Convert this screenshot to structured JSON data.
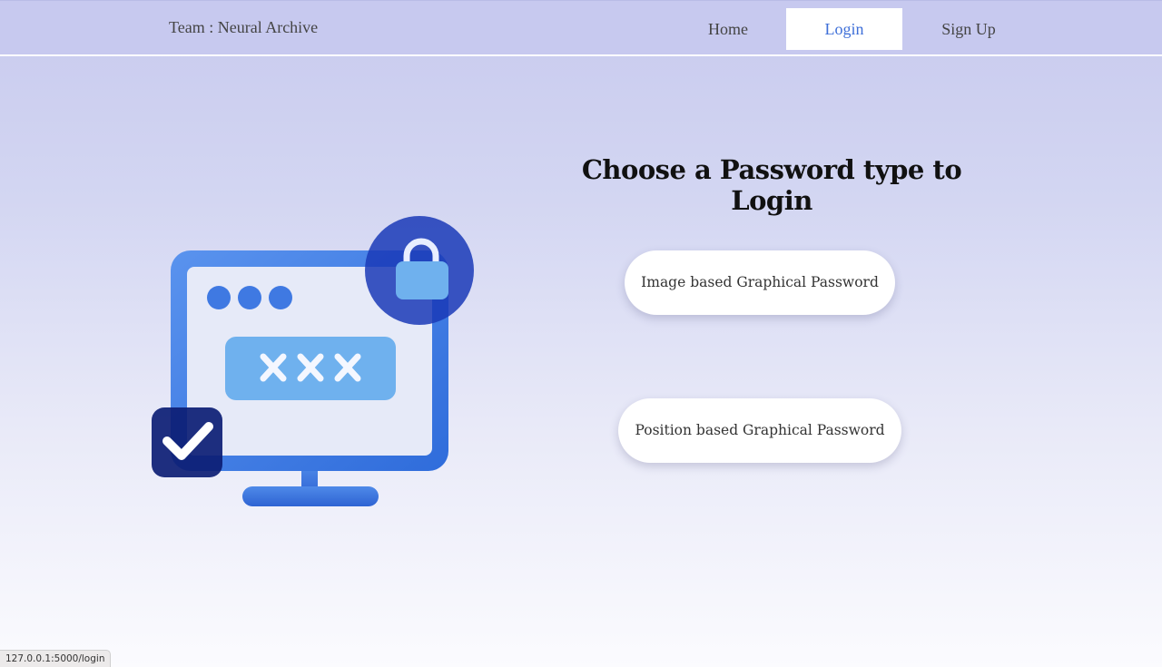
{
  "navbar": {
    "brand": "Team : Neural Archive",
    "items": [
      {
        "label": "Home",
        "active": false
      },
      {
        "label": "Login",
        "active": true
      },
      {
        "label": "Sign Up",
        "active": false
      }
    ]
  },
  "main": {
    "heading": "Choose a Password type to Login",
    "options": [
      {
        "label": "Image based Graphical Password"
      },
      {
        "label": "Position based Graphical Password"
      }
    ]
  },
  "illustration": {
    "icon": "monitor-password-lock-icon",
    "password_mask": "XXX",
    "colors": {
      "monitor": "#3f7ce3",
      "screen": "#e6eaf8",
      "lock_circle": "#1a3ab7",
      "check_square": "#0c1d74",
      "password_field": "#6fb1ee"
    }
  },
  "status_bar": {
    "url": "127.0.0.1:5000/login"
  },
  "theme": {
    "accent": "#3e6fd8",
    "navbar_bg": "#c7c9ef"
  }
}
